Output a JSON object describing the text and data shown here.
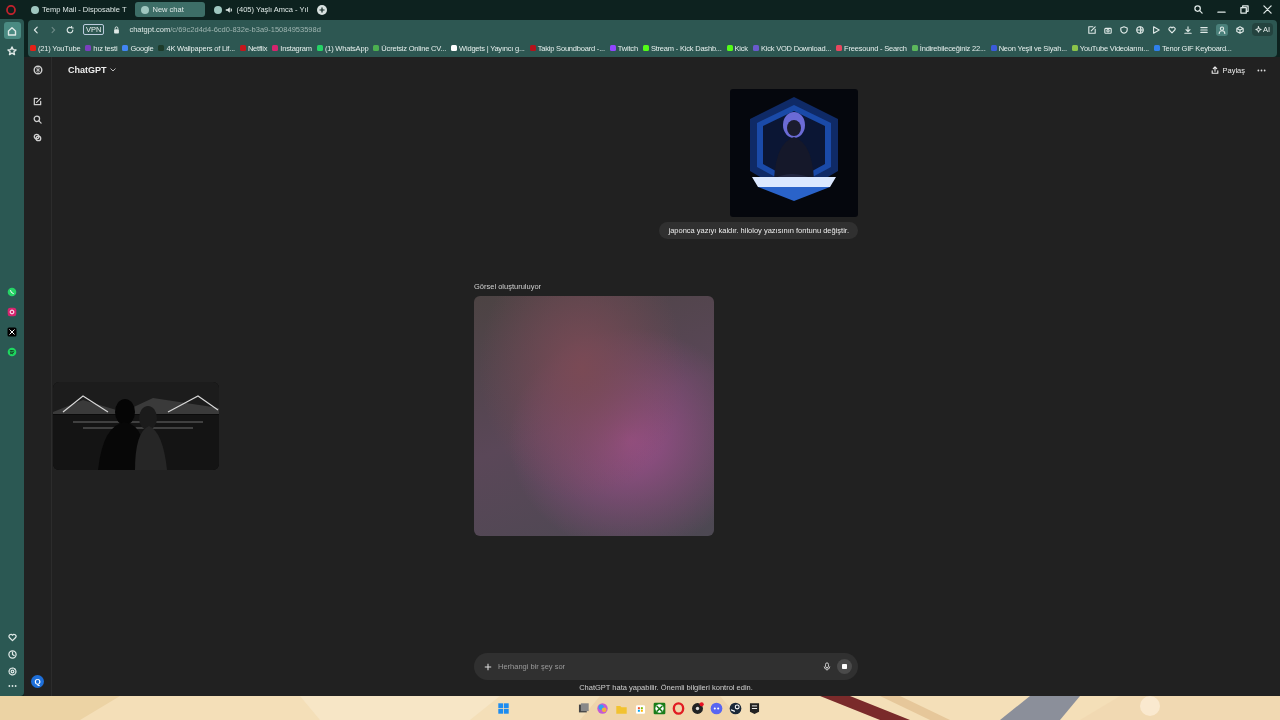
{
  "tabs": [
    {
      "title": "Temp Mail - Disposable T",
      "selected": false,
      "audio": false
    },
    {
      "title": "New chat",
      "selected": true,
      "audio": false
    },
    {
      "title": "(405) Yaşlı Amca - Yıl",
      "selected": false,
      "audio": true
    }
  ],
  "address": {
    "vpn_label": "VPN",
    "domain": "chatgpt.com",
    "path": "/c/69c2d4d4-6cd0-832e-b3a9-15084953598d",
    "ai_label": "AI"
  },
  "bookmarks": [
    {
      "label": "(21) YouTube",
      "color": "#e62117"
    },
    {
      "label": "hız testi",
      "color": "#7a3fbf"
    },
    {
      "label": "Google",
      "color": "#4285f4"
    },
    {
      "label": "4K Wallpapers of Lif...",
      "color": "#1d3b2a"
    },
    {
      "label": "Netflix",
      "color": "#c4161c"
    },
    {
      "label": "Instagram",
      "color": "#d6246e"
    },
    {
      "label": "(1) WhatsApp",
      "color": "#25d366"
    },
    {
      "label": "Ücretsiz Online CV...",
      "color": "#4caf50"
    },
    {
      "label": "Widgets | Yayıncı g...",
      "color": "#ffffff"
    },
    {
      "label": "Takip Soundboard -...",
      "color": "#b5121b"
    },
    {
      "label": "Twitch",
      "color": "#9146ff"
    },
    {
      "label": "Stream - Kick Dashb...",
      "color": "#53fc18"
    },
    {
      "label": "Kick",
      "color": "#53fc18"
    },
    {
      "label": "Kick VOD Download...",
      "color": "#6a5acd"
    },
    {
      "label": "Freesound - Search",
      "color": "#e8475f"
    },
    {
      "label": "İndirebileceğiniz 22...",
      "color": "#5cb85c"
    },
    {
      "label": "Neon Yeşil ve Siyah...",
      "color": "#3b5bdb"
    },
    {
      "label": "YouTube Videolarını...",
      "color": "#8bc34a"
    },
    {
      "label": "Tenor GIF Keyboard...",
      "color": "#2f80ed"
    }
  ],
  "opera_sidebar": {
    "items": [
      {
        "kind": "home",
        "selected": true
      },
      {
        "kind": "star",
        "selected": false
      },
      {
        "kind": "whatsapp",
        "selected": false
      },
      {
        "kind": "instagram",
        "selected": false
      },
      {
        "kind": "x",
        "selected": false
      },
      {
        "kind": "spotify",
        "selected": false
      }
    ]
  },
  "chat": {
    "app_title": "ChatGPT",
    "share_label": "Paylaş",
    "avatar_initial": "Q",
    "messages": [
      {
        "kind": "user_image"
      },
      {
        "kind": "user_text",
        "text": "japonca yazıyı kaldır. hiloloy yazısının fontunu değiştir."
      },
      {
        "kind": "generating",
        "text": "Görsel oluşturuluyor"
      }
    ],
    "composer": {
      "placeholder": "Herhangi bir şey sor"
    },
    "disclaimer": "ChatGPT hata yapabilir. Önemli bilgileri kontrol edin."
  }
}
